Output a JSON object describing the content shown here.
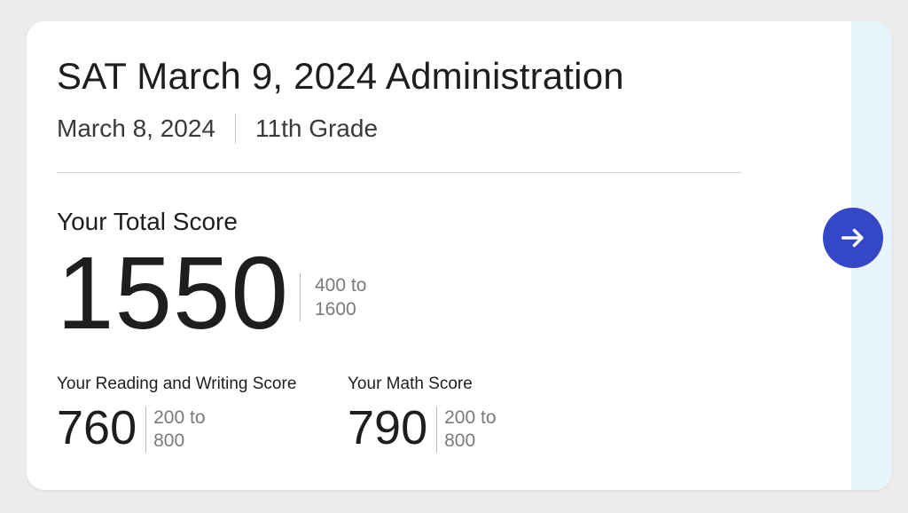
{
  "card": {
    "title": "SAT March 9, 2024 Administration",
    "date": "March 8, 2024",
    "grade": "11th Grade",
    "total": {
      "label": "Your Total Score",
      "value": "1550",
      "range_low": "400 to",
      "range_high": "1600"
    },
    "reading_writing": {
      "label": "Your Reading and Writing Score",
      "value": "760",
      "range_low": "200 to",
      "range_high": "800"
    },
    "math": {
      "label": "Your Math Score",
      "value": "790",
      "range_low": "200 to",
      "range_high": "800"
    },
    "open_button_icon": "arrow-right-icon"
  },
  "colors": {
    "accent": "#3447c6",
    "strip": "#e8f4fb",
    "background": "#ececec"
  }
}
